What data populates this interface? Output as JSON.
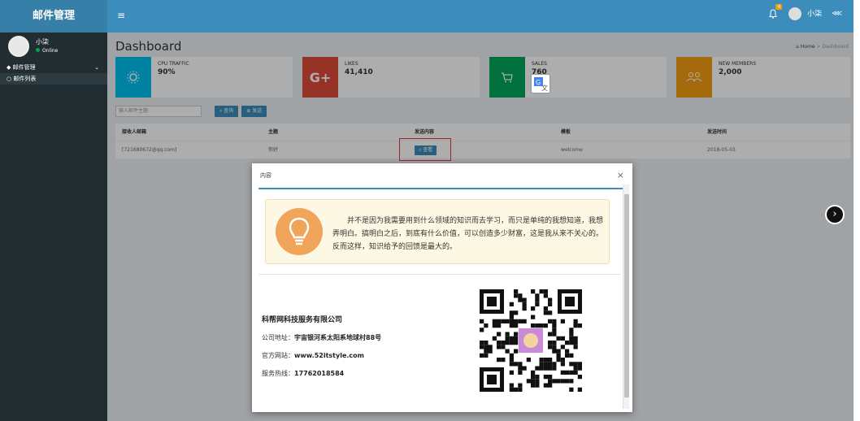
{
  "app": {
    "brand": "邮件管理",
    "toggle": "≡"
  },
  "topbar": {
    "badge": "4",
    "user": "小柒",
    "share": "⋘"
  },
  "sidebar": {
    "user_name": "小柒",
    "user_status": "Online",
    "menu_label": "邮件管理",
    "menu_arrow": "⌄",
    "submenu_label": "邮件列表"
  },
  "page": {
    "title": "Dashboard",
    "breadcrumb_home": "Home",
    "breadcrumb_sep": ">",
    "breadcrumb_current": "Dashboard"
  },
  "info_boxes": [
    {
      "label": "CPU TRAFFIC",
      "value": "90%",
      "color": "#00c0ef"
    },
    {
      "label": "LIKES",
      "value": "41,410",
      "color": "#dd4b39"
    },
    {
      "label": "SALES",
      "value": "760",
      "color": "#00a65a"
    },
    {
      "label": "NEW MEMBERS",
      "value": "2,000",
      "color": "#f39c12"
    }
  ],
  "toolbar": {
    "search_placeholder": "输入邮件主题",
    "query_label": "查询",
    "send_label": "发送"
  },
  "table": {
    "headers": [
      "接收人邮箱",
      "主题",
      "发送内容",
      "模板",
      "发送时间"
    ],
    "rows": [
      {
        "email": "[721680672@qq.com]",
        "subject": "你好",
        "content_btn": "查看",
        "template": "welcome",
        "time": "2018-05-03"
      }
    ]
  },
  "modal": {
    "title": "内容",
    "close": "×",
    "notice": "并不是因为我需要用到什么领域的知识而去学习，而只是单纯的我想知道，我想弄明白。搞明白之后，到底有什么价值，可以创造多少财富，这是我从来不关心的。反而这样，知识给予的回馈是最大的。",
    "company_name": "科帮网科技服务有限公司",
    "address_label": "公司地址：",
    "address": "宇宙银河系太阳系地球村88号",
    "website_label": "官方网站：",
    "website": "www.52itstyle.com",
    "hotline_label": "服务热线：",
    "hotline": "17762018584"
  },
  "nav": {
    "next_icon": "›"
  },
  "colors": {
    "primary": "#3c8dbc",
    "sidebar_bg": "#222d32",
    "content_bg": "#ecf0f5",
    "notice_bg": "#fcf8e3",
    "bulb": "#f0a55a"
  }
}
